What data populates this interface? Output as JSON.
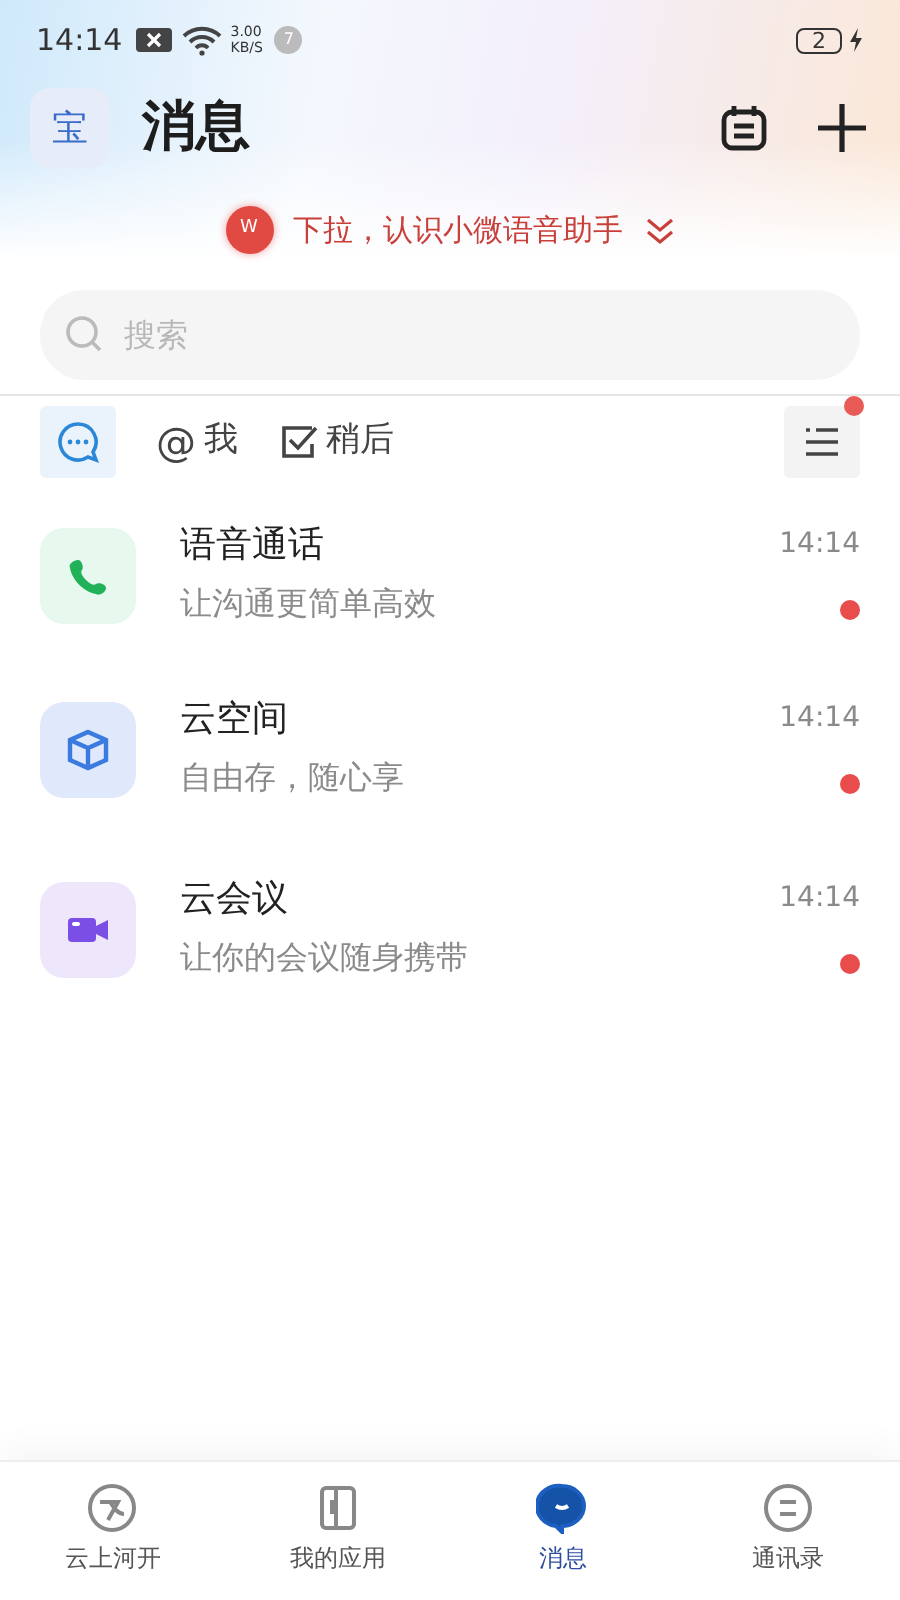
{
  "status_bar": {
    "time": "14:14",
    "speed": "3.00",
    "speed_unit": "KB/S",
    "notification_count": "7",
    "battery": "2",
    "charging": true
  },
  "header": {
    "avatar": "宝",
    "title": "消息"
  },
  "banner": {
    "logo": "W",
    "text": "下拉，认识小微语音助手"
  },
  "search": {
    "placeholder": "搜索"
  },
  "filters": [
    {
      "kind": "chat",
      "selected": true
    },
    {
      "kind": "mention",
      "symbol": "@",
      "label": "我",
      "selected": false
    },
    {
      "kind": "later",
      "label": "稍后",
      "selected": false
    }
  ],
  "filter_menu": {
    "has_badge": true
  },
  "conversations": [
    {
      "kind": "phone",
      "title": "语音通话",
      "subtitle": "让沟通更简单高效",
      "time": "14:14",
      "unread": true
    },
    {
      "kind": "cube",
      "title": "云空间",
      "subtitle": "自由存，随心享",
      "time": "14:14",
      "unread": true
    },
    {
      "kind": "video",
      "title": "云会议",
      "subtitle": "让你的会议随身携带",
      "time": "14:14",
      "unread": true
    }
  ],
  "bottom_nav": [
    {
      "kind": "home",
      "label": "云上河开",
      "selected": false
    },
    {
      "kind": "apps",
      "label": "我的应用",
      "selected": false
    },
    {
      "kind": "messages",
      "label": "消息",
      "selected": true
    },
    {
      "kind": "contacts",
      "label": "通讯录",
      "selected": false
    }
  ]
}
